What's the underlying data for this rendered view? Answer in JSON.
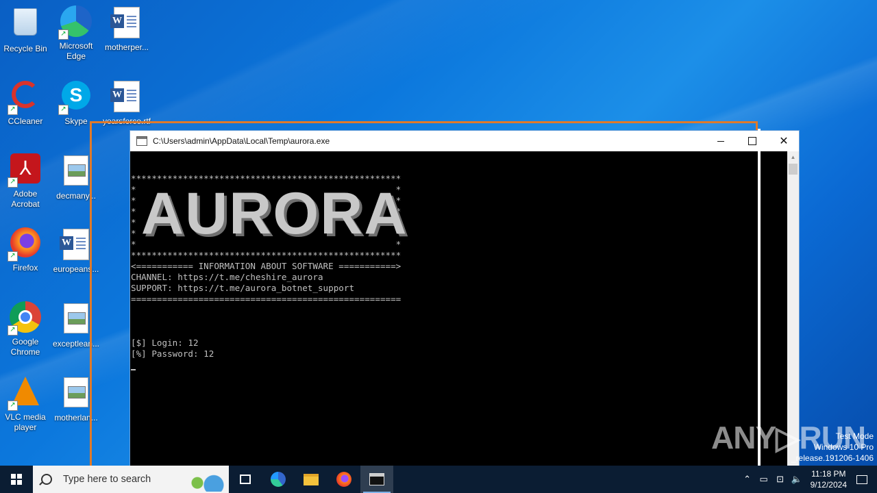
{
  "desktop": {
    "icons": [
      {
        "label": "Recycle Bin"
      },
      {
        "label": "Microsoft Edge"
      },
      {
        "label": "motherper..."
      },
      {
        "label": "CCleaner"
      },
      {
        "label": "Skype"
      },
      {
        "label": "yearsforce.rtf"
      },
      {
        "label": "Adobe Acrobat"
      },
      {
        "label": "decmany..."
      },
      {
        "label": "Firefox"
      },
      {
        "label": "europeans..."
      },
      {
        "label": "Google Chrome"
      },
      {
        "label": "exceptlean..."
      },
      {
        "label": "VLC media player"
      },
      {
        "label": "motherlan..."
      }
    ]
  },
  "window": {
    "title": "C:\\Users\\admin\\AppData\\Local\\Temp\\aurora.exe",
    "minimize": "—",
    "close": "✕"
  },
  "console": {
    "lines": [
      "****************************************************",
      "*                                                  *",
      "*                                                  *",
      "*                                                  *",
      "*                                                  *",
      "*                                                  *",
      "*                                                  *",
      "****************************************************",
      "<=========== INFORMATION ABOUT SOFTWARE ===========>",
      "CHANNEL: https://t.me/cheshire_aurora",
      "SUPPORT: https://t.me/aurora_botnet_support",
      "====================================================",
      "",
      "",
      "",
      "[$] Login: 12",
      "[%] Password: 12"
    ],
    "banner": "AURORA"
  },
  "overlay": {
    "watermark": "ANY▷RUN",
    "test_mode": [
      "Test Mode",
      "Windows 10 Pro",
      "_release.191206-1406"
    ]
  },
  "taskbar": {
    "search_placeholder": "Type here to search",
    "time": "11:18 PM",
    "date": "9/12/2024"
  }
}
